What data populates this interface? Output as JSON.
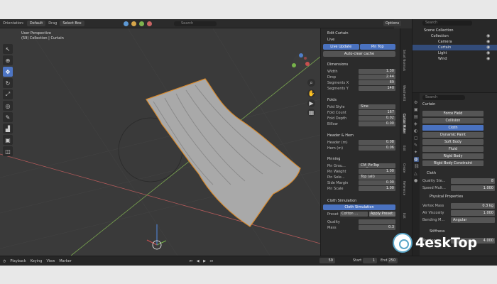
{
  "header": {
    "orientation_label": "Orientation:",
    "orientation_value": "Default",
    "drag_label": "Drag",
    "select_mode": "Select Box",
    "search_placeholder": "Search",
    "options_label": "Options"
  },
  "viewport": {
    "view_name": "User Perspective",
    "collection_path": "(59) Collection | Curtain"
  },
  "npanel": {
    "edit_title": "Edit Curtain",
    "live_label": "Live",
    "live_update_btn": "Live Update",
    "pin_top_btn": "Pin Top",
    "auto_clear_btn": "Auto-clear cache",
    "dimensions_title": "Dimensions",
    "dims": [
      {
        "k": "Width",
        "v": "1.30"
      },
      {
        "k": "Drop",
        "v": "2.44"
      },
      {
        "k": "Segments X",
        "v": "89"
      },
      {
        "k": "Segments Y",
        "v": "140"
      }
    ],
    "folds_title": "Folds",
    "fold_style_label": "Fold Style",
    "fold_style_value": "Sine",
    "folds": [
      {
        "k": "Fold Count",
        "v": "167"
      },
      {
        "k": "Fold Depth",
        "v": "0.02"
      },
      {
        "k": "Billow",
        "v": "0.00"
      }
    ],
    "header_hem_title": "Header & Hem",
    "hems": [
      {
        "k": "Header (m)",
        "v": "0.08"
      },
      {
        "k": "Hem (m)",
        "v": "0.06"
      }
    ],
    "pinning_title": "Pinning",
    "pin_group_label": "Pin Grou...",
    "pin_group_value": "CM_PinTop",
    "pin_weight": {
      "k": "Pin Weight",
      "v": "1.00"
    },
    "pin_sel_label": "Pin Sele...",
    "pin_sel_value": "Top (all)",
    "pin_rows": [
      {
        "k": "Side Margin",
        "v": "0.00"
      },
      {
        "k": "Pin Scale",
        "v": "1.00"
      }
    ],
    "cloth_sim_title": "Cloth Simulation",
    "cloth_sim_btn": "Cloth Simulation",
    "preset_label": "Preset:",
    "preset_value": "Cotton ...",
    "apply_preset": "Apply Preset",
    "quality_label": "Quality",
    "mass_label": "Mass",
    "mass_value": "0.3"
  },
  "vtabs": [
    "Smart Normals",
    "WeatherKit",
    "Curtain Maker",
    "Edit",
    "Create",
    "Reference",
    "Edit"
  ],
  "outliner": {
    "search_placeholder": "Search",
    "title": "Scene Collection",
    "items": [
      "Collection",
      "Camera",
      "Curtain",
      "Light",
      "Wind"
    ]
  },
  "props": {
    "object_name": "Curtain",
    "physics_buttons": [
      "Force Field",
      "Collision",
      "Cloth",
      "Dynamic Paint",
      "Soft Body",
      "Fluid",
      "Rigid Body",
      "Rigid Body Constraint"
    ],
    "cloth_title": "Cloth",
    "quality_steps": {
      "k": "Quality Ste...",
      "v": "8"
    },
    "speed_mult": {
      "k": "Speed Mult...",
      "v": "1.000"
    },
    "phys_props_title": "Physical Properties",
    "vertex_mass": {
      "k": "Vertex Mass",
      "v": "0.3 kg"
    },
    "air_visc": {
      "k": "Air Viscosity",
      "v": "1.000"
    },
    "bending": {
      "k": "Bending M...",
      "v": "Angular"
    },
    "stiffness_title": "Stiffness",
    "tension": {
      "k": "Tension",
      "v": "4.000"
    }
  },
  "timeline": {
    "playback": "Playback",
    "keying": "Keying",
    "view": "View",
    "marker": "Marker",
    "current_frame": "59",
    "start_label": "Start",
    "start_value": "1",
    "end_label": "End",
    "end_value": "250"
  },
  "watermark": {
    "text": "4eskTop"
  }
}
